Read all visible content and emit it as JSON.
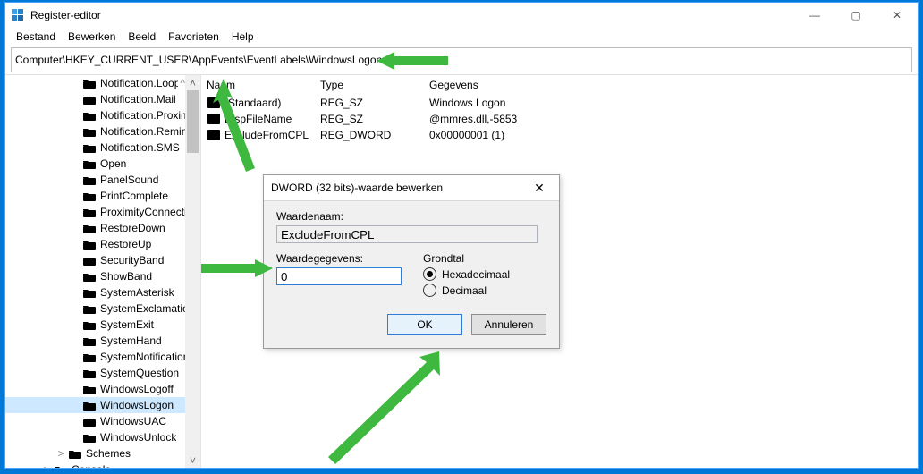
{
  "window": {
    "title": "Register-editor",
    "sys": {
      "min": "—",
      "max": "▢",
      "close": "✕"
    }
  },
  "menu": [
    "Bestand",
    "Bewerken",
    "Beeld",
    "Favorieten",
    "Help"
  ],
  "address": "Computer\\HKEY_CURRENT_USER\\AppEvents\\EventLabels\\WindowsLogon",
  "tree": {
    "items": [
      {
        "label": "Notification.Loopin"
      },
      {
        "label": "Notification.Mail"
      },
      {
        "label": "Notification.Proxim"
      },
      {
        "label": "Notification.Remin"
      },
      {
        "label": "Notification.SMS"
      },
      {
        "label": "Open"
      },
      {
        "label": "PanelSound"
      },
      {
        "label": "PrintComplete"
      },
      {
        "label": "ProximityConnecti"
      },
      {
        "label": "RestoreDown"
      },
      {
        "label": "RestoreUp"
      },
      {
        "label": "SecurityBand"
      },
      {
        "label": "ShowBand"
      },
      {
        "label": "SystemAsterisk"
      },
      {
        "label": "SystemExclamation"
      },
      {
        "label": "SystemExit"
      },
      {
        "label": "SystemHand"
      },
      {
        "label": "SystemNotification"
      },
      {
        "label": "SystemQuestion"
      },
      {
        "label": "WindowsLogoff"
      },
      {
        "label": "WindowsLogon",
        "selected": true
      },
      {
        "label": "WindowsUAC"
      },
      {
        "label": "WindowsUnlock"
      }
    ],
    "tail": [
      {
        "label": "Schemes",
        "level": 1,
        "exp": ">"
      },
      {
        "label": "Console",
        "level": 2,
        "exp": ">"
      }
    ],
    "scroll_indicator": "^"
  },
  "list": {
    "headers": {
      "name": "Naam",
      "type": "Type",
      "data": "Gegevens"
    },
    "rows": [
      {
        "icon": "string",
        "name": "(Standaard)",
        "type": "REG_SZ",
        "data": "Windows Logon"
      },
      {
        "icon": "string",
        "name": "DispFileName",
        "type": "REG_SZ",
        "data": "@mmres.dll,-5853"
      },
      {
        "icon": "binary",
        "name": "ExcludeFromCPL",
        "type": "REG_DWORD",
        "data": "0x00000001 (1)"
      }
    ]
  },
  "dialog": {
    "title": "DWORD (32 bits)-waarde bewerken",
    "close": "✕",
    "name_label": "Waardenaam:",
    "name_value": "ExcludeFromCPL",
    "data_label": "Waardegegevens:",
    "data_value": "0",
    "base_label": "Grondtal",
    "radio_hex": "Hexadecimaal",
    "radio_dec": "Decimaal",
    "ok": "OK",
    "cancel": "Annuleren"
  }
}
